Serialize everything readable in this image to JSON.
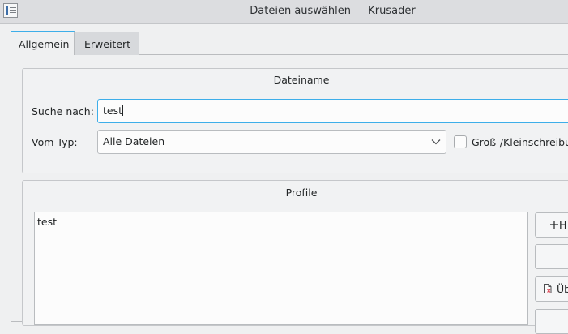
{
  "window": {
    "title": "Dateien auswählen — Krusader"
  },
  "tabs": [
    {
      "label": "Allgemein"
    },
    {
      "label": "Erweitert"
    }
  ],
  "dateiname": {
    "title": "Dateiname",
    "search_label": "Suche nach:",
    "search_value": "test",
    "type_label": "Vom Typ:",
    "type_value": "Alle Dateien",
    "case_label": "Groß-/Kleinschreibu"
  },
  "profile": {
    "title": "Profile",
    "items": [
      "test"
    ],
    "buttons": [
      {
        "label": "H",
        "icon": "plus-icon"
      },
      {
        "label": "",
        "icon": ""
      },
      {
        "label": "Üb",
        "icon": "document-overwrite-icon"
      }
    ]
  },
  "colors": {
    "accent": "#3daee9",
    "window_bg": "#eff0f1",
    "titlebar_bg": "#dcdde0"
  }
}
